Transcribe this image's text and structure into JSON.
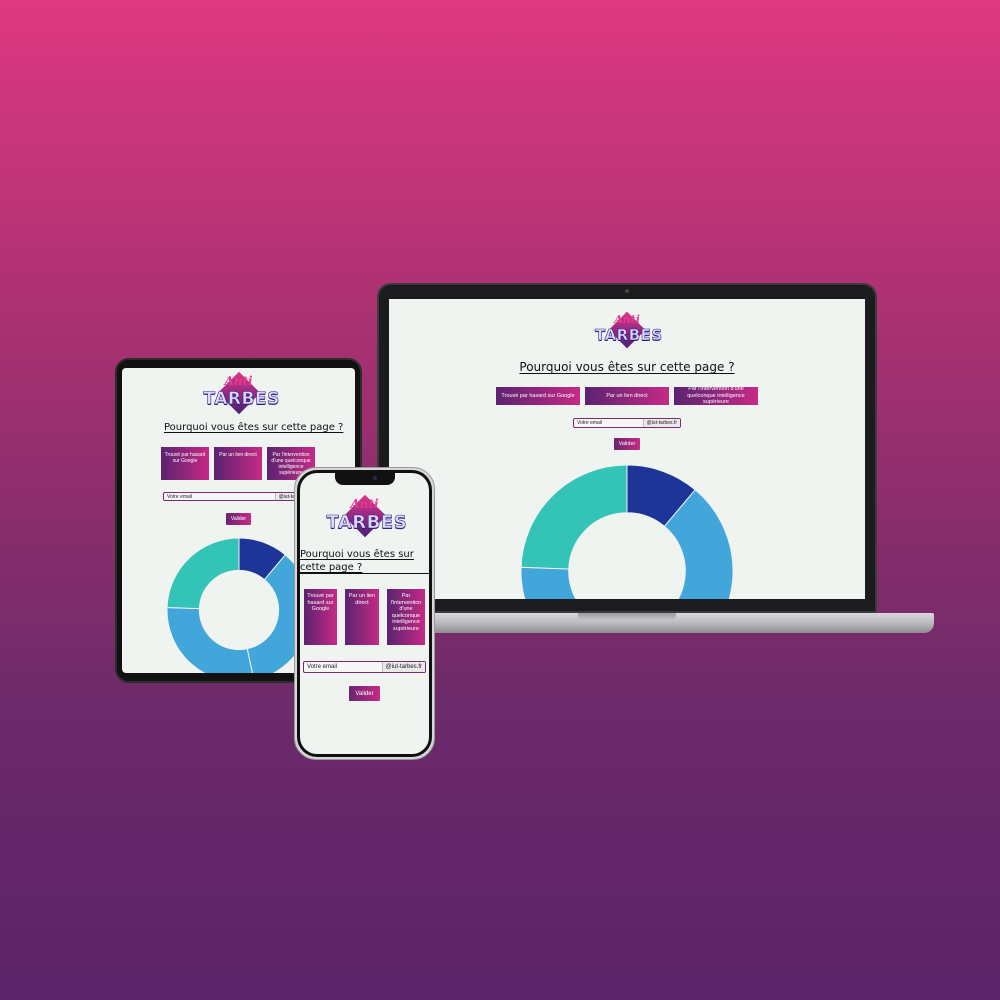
{
  "brand": {
    "logo_script": "Anti",
    "logo_word": "TARBES"
  },
  "form": {
    "question": "Pourquoi vous êtes sur cette page ?",
    "choices": [
      "Trouvé par hasard sur Google",
      "Par un lien direct",
      "Par l'intervention d'une quelconque intelligence supérieure"
    ],
    "email_placeholder": "Votre email",
    "email_domain": "@iut-tarbes.fr",
    "submit_label": "Valider"
  },
  "chart_data": {
    "type": "pie",
    "values": [
      10,
      32,
      26,
      22
    ],
    "colors": [
      "#1c3596",
      "#42a6da",
      "#42a6da",
      "#33c3b7"
    ],
    "hole": 0.55
  }
}
